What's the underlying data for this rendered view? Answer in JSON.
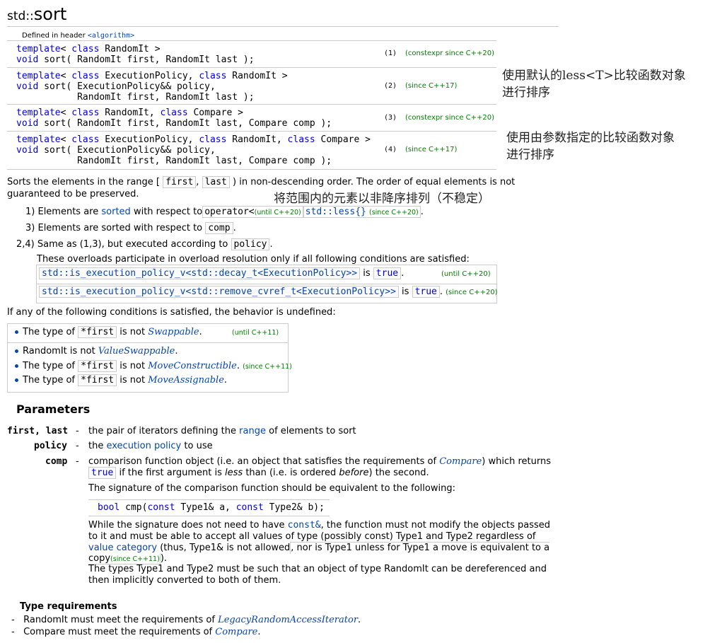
{
  "title": {
    "prefix": "std::",
    "name": "sort"
  },
  "header_note": {
    "text": "Defined in header ",
    "header": "<algorithm>"
  },
  "decls": [
    {
      "lines": [
        "template< class RandomIt >",
        "void sort( RandomIt first, RandomIt last );"
      ],
      "num": "(1)",
      "note": "(constexpr since C++20)"
    },
    {
      "lines": [
        "template< class ExecutionPolicy, class RandomIt >",
        "void sort( ExecutionPolicy&& policy,",
        "           RandomIt first, RandomIt last );"
      ],
      "num": "(2)",
      "note": "(since C++17)"
    },
    {
      "lines": [
        "template< class RandomIt, class Compare >",
        "void sort( RandomIt first, RandomIt last, Compare comp );"
      ],
      "num": "(3)",
      "note": "(constexpr since C++20)"
    },
    {
      "lines": [
        "template< class ExecutionPolicy, class RandomIt, class Compare >",
        "void sort( ExecutionPolicy&& policy,",
        "           RandomIt first, RandomIt last, Compare comp );"
      ],
      "num": "(4)",
      "note": "(since C++17)"
    }
  ],
  "annotations": {
    "a1_line1": "使用默认的less<T>比较函数对象",
    "a1_line2": "进行排序",
    "a2_line1": "使用由参数指定的比较函数对象",
    "a2_line2": "进行排序",
    "a3": "将范围内的元素以非降序排列（不稳定）"
  },
  "desc": {
    "p1_a": "Sorts the elements in the range [",
    "first": "first",
    "comma": ",",
    "last": "last",
    "p1_b": ") in non-descending order. The order of equal elements is not",
    "p1_c": "guaranteed to be preserved.",
    "i1_num": "1)",
    "i1_a": "Elements are",
    "i1_sorted": "sorted",
    "i1_b": "with respect to",
    "i1_op": "operator<",
    "i1_until": "(until C++20)",
    "i1_less": "std::less{}",
    "i1_since": "(since C++20)",
    "i3_num": "3)",
    "i3_a": "Elements are sorted with respect to",
    "i3_comp": "comp",
    "i24_num": "2,4)",
    "i24_a": "Same as (1,3), but executed according to",
    "i24_policy": "policy",
    "i24_b": "These overloads participate in overload resolution only if all following conditions are satisfied:",
    "c1_code": "std::is_execution_policy_v<std::decay_t<ExecutionPolicy>>",
    "c1_is": "is",
    "c1_true": "true",
    "c1_note": "(until C++20)",
    "c2_code": "std::is_execution_policy_v<std::remove_cvref_t<ExecutionPolicy>>",
    "c2_is": "is",
    "c2_true": "true",
    "c2_note": "(since C++20)",
    "undef": "If any of the following conditions is satisfied, the behavior is undefined:"
  },
  "ub": {
    "r1_a": "The type of",
    "r1_code": "*first",
    "r1_b": "is not",
    "r1_link": "Swappable",
    "r1_note": "(until C++11)",
    "r2_a": "RandomIt is not",
    "r2_link": "ValueSwappable",
    "r3_a": "The type of",
    "r3_code": "*first",
    "r3_b": "is not",
    "r3_link": "MoveConstructible",
    "r3_note": "(since C++11)",
    "r4_a": "The type of",
    "r4_code": "*first",
    "r4_b": "is not",
    "r4_link": "MoveAssignable"
  },
  "params": {
    "heading": "Parameters",
    "p1_name": "first, last",
    "p1_a": "the pair of iterators defining the",
    "p1_link": "range",
    "p1_b": "of elements to sort",
    "p2_name": "policy",
    "p2_a": "the",
    "p2_link": "execution policy",
    "p2_b": "to use",
    "p3_name": "comp",
    "p3_l1a": "comparison function object (i.e. an object that satisfies the requirements of",
    "p3_l1link": "Compare",
    "p3_l1b": ") which returns",
    "p3_true": "true",
    "p3_l2a": "if the first argument is",
    "p3_less": "less",
    "p3_l2b": "than (i.e. is ordered",
    "p3_before": "before",
    "p3_l2c": ") the second.",
    "p3_sig": "The signature of the comparison function should be equivalent to the following:",
    "code_bool": "bool",
    "code_cmp": " cmp(",
    "code_const1": "const",
    "code_t1": " Type1& a, ",
    "code_const2": "const",
    "code_t2": " Type2& b);",
    "w1_a": "While the signature does not need to have",
    "w1_const": "const&",
    "w1_b": ", the function must not modify the objects passed",
    "w2": "to it and must be able to accept all values of type (possibly const) Type1 and Type2 regardless of",
    "w3_link": "value category",
    "w3_a": "(thus, Type1& is not allowed",
    "w3_b": ", nor is Type1 unless for Type1 a move is equivalent to a",
    "w4_a": "copy",
    "w4_note": "(since C++11)",
    "w4_b": ").",
    "t1": "The types Type1 and Type2 must be such that an object of type RandomIt can be dereferenced and",
    "t2": "then implicitly converted to both of them."
  },
  "typereq": {
    "heading": "Type requirements",
    "r1_dash": "-",
    "r1_a": "RandomIt must meet the requirements of",
    "r1_link": "LegacyRandomAccessIterator",
    "r1_b": ".",
    "r2_dash": "-",
    "r2_a": "Compare must meet the requirements of",
    "r2_link": "Compare",
    "r2_b": "."
  }
}
